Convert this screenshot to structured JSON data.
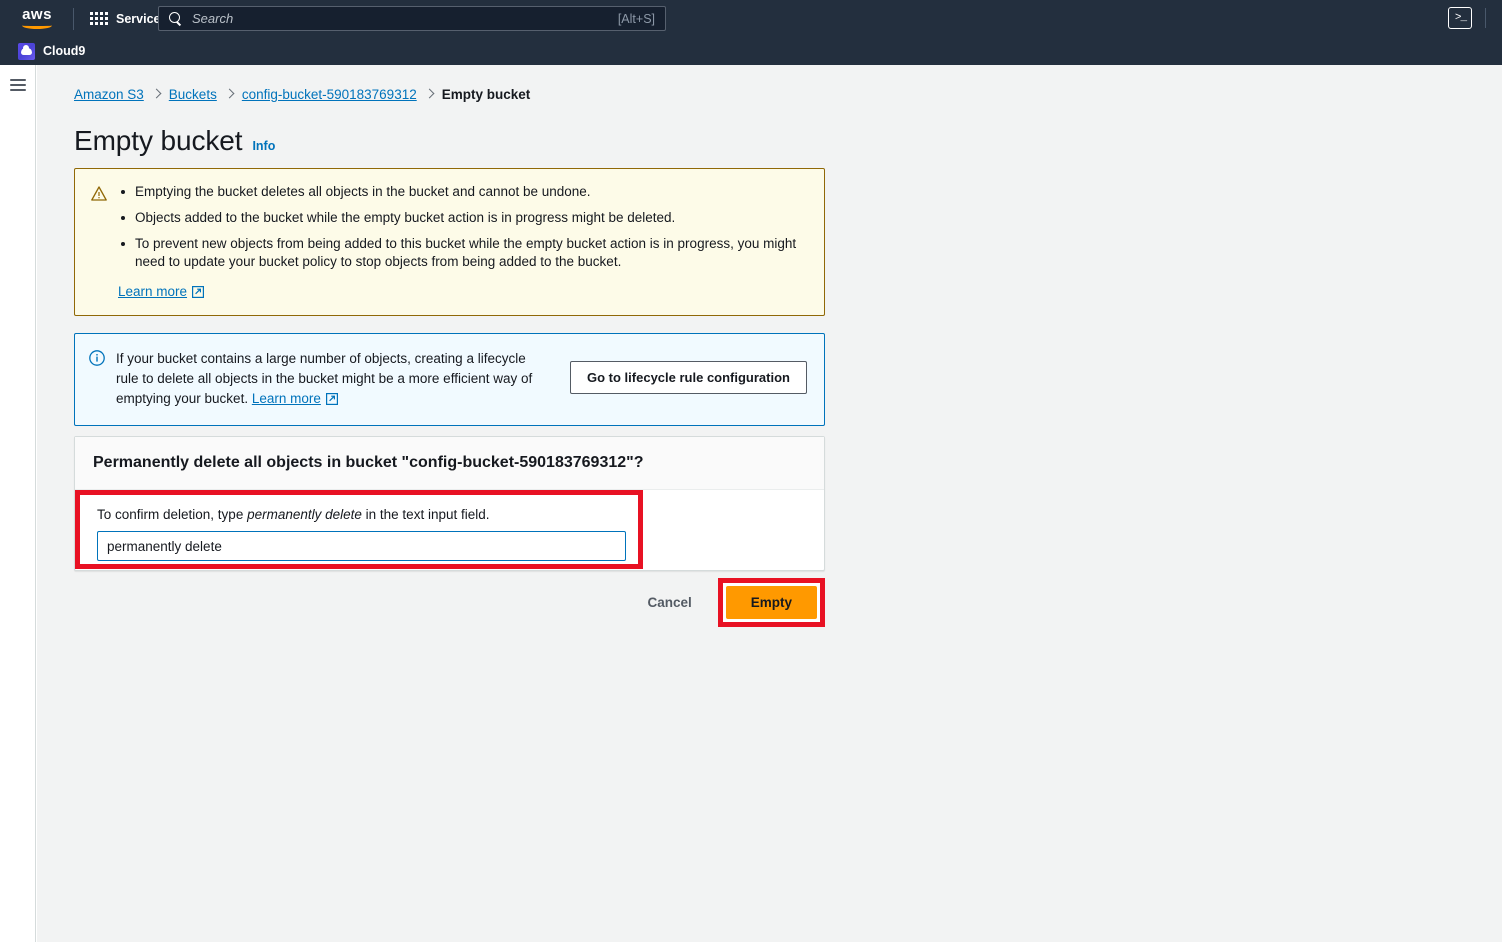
{
  "topnav": {
    "logo_text": "aws",
    "services_label": "Services",
    "search": {
      "placeholder": "Search",
      "shortcut": "[Alt+S]"
    },
    "cloudshell_glyph": ">_"
  },
  "subnav": {
    "app_label": "Cloud9"
  },
  "breadcrumb": [
    {
      "label": "Amazon S3",
      "current": false
    },
    {
      "label": "Buckets",
      "current": false
    },
    {
      "label": "config-bucket-590183769312",
      "current": false
    },
    {
      "label": "Empty bucket",
      "current": true
    }
  ],
  "page": {
    "title": "Empty bucket",
    "info_label": "Info"
  },
  "warning_alert": {
    "icon": "warning-triangle-icon",
    "bullets": [
      "Emptying the bucket deletes all objects in the bucket and cannot be undone.",
      "Objects added to the bucket while the empty bucket action is in progress might be deleted.",
      "To prevent new objects from being added to this bucket while the empty bucket action is in progress, you might need to update your bucket policy to stop objects from being added to the bucket."
    ],
    "learn_more": "Learn more",
    "border_color": "#906806",
    "background_color": "#fdfbe8"
  },
  "info_alert": {
    "icon": "info-circle-icon",
    "text_part1": "If your bucket contains a large number of objects, creating a lifecycle rule to delete all objects in the bucket might be a more efficient way of emptying your bucket. ",
    "learn_more": "Learn more",
    "button_label": "Go to lifecycle rule configuration",
    "border_color": "#0073bb",
    "background_color": "#f1faff"
  },
  "panel": {
    "header": "Permanently delete all objects in bucket \"config-bucket-590183769312\"?",
    "confirm_label_part1": "To confirm deletion, type ",
    "confirm_label_emphasis": "permanently delete",
    "confirm_label_part2": " in the text input field.",
    "input_value": "permanently delete",
    "input_placeholder": "permanently delete"
  },
  "actions": {
    "cancel_label": "Cancel",
    "empty_label": "Empty"
  },
  "colors": {
    "nav_background": "#232f3e",
    "accent_orange": "#ff9900",
    "link_blue": "#0073bb",
    "highlight_red": "#e81123",
    "page_background": "#f2f3f3"
  }
}
